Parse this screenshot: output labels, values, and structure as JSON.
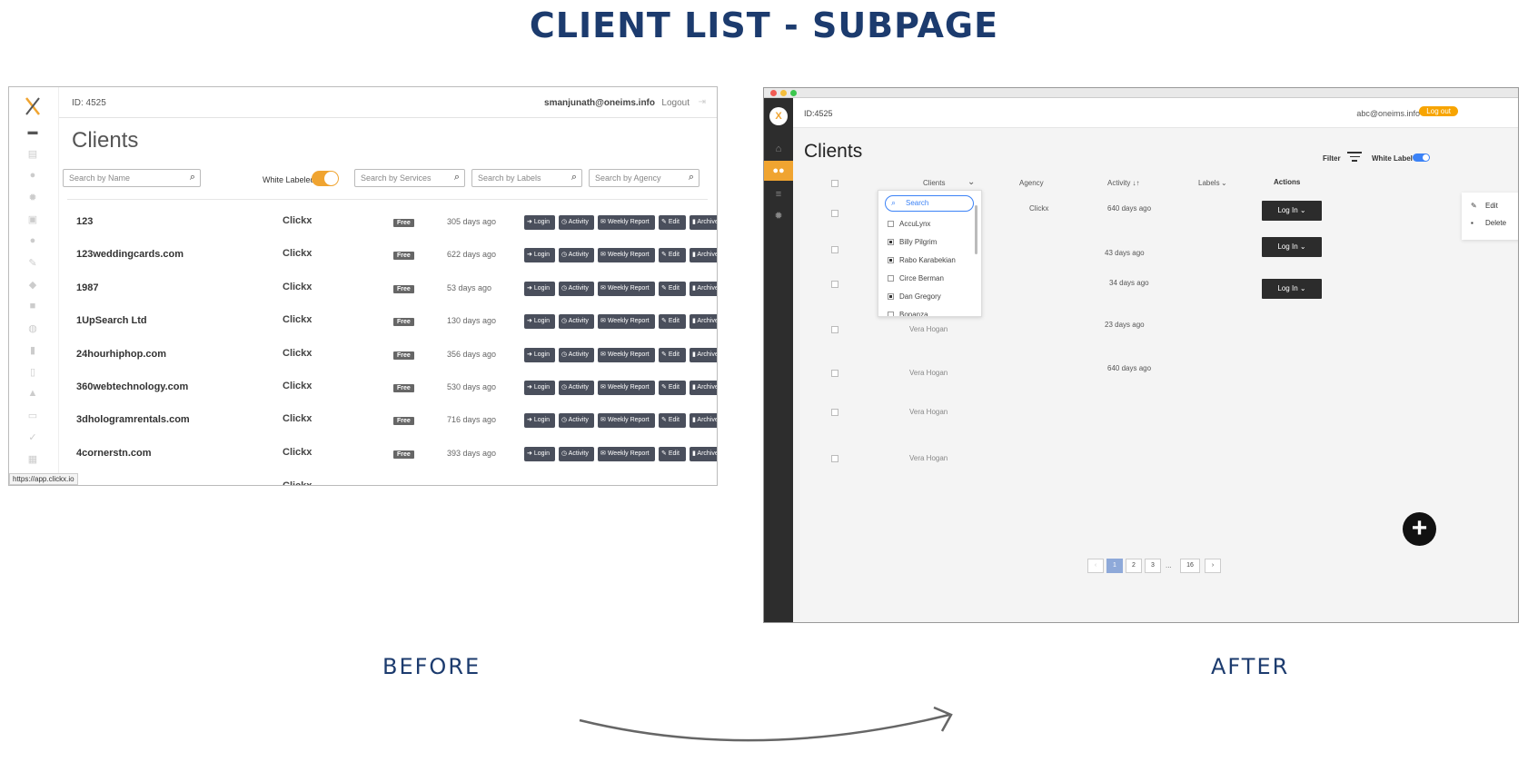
{
  "title": "CLIENT LIST - SUBPAGE",
  "captions": {
    "before": "BEFORE",
    "after": "AFTER"
  },
  "before": {
    "logo_icon": "x-logo-icon",
    "topbar": {
      "id": "ID: 4525",
      "email": "smanjunath@oneims.info",
      "logout": "Logout"
    },
    "heading": "Clients",
    "search": {
      "name": "Search by Name",
      "services": "Search by Services",
      "labels": "Search by Labels",
      "agency": "Search by Agency"
    },
    "white_labeled_label": "White Labeled",
    "white_labeled_on": true,
    "badge_label": "Free",
    "buttons": {
      "login": "Login",
      "activity": "Activity",
      "weekly_report": "Weekly Report",
      "edit": "Edit",
      "archive": "Archive"
    },
    "rows": [
      {
        "name": "123",
        "agency": "Clickx",
        "days": "305 days ago"
      },
      {
        "name": "123weddingcards.com",
        "agency": "Clickx",
        "days": "622 days ago"
      },
      {
        "name": "1987",
        "agency": "Clickx",
        "days": "53 days ago"
      },
      {
        "name": "1UpSearch Ltd",
        "agency": "Clickx",
        "days": "130 days ago"
      },
      {
        "name": "24hourhiphop.com",
        "agency": "Clickx",
        "days": "356 days ago"
      },
      {
        "name": "360webtechnology.com",
        "agency": "Clickx",
        "days": "530 days ago"
      },
      {
        "name": "3dhologramrentals.com",
        "agency": "Clickx",
        "days": "716 days ago"
      },
      {
        "name": "4cornerstn.com",
        "agency": "Clickx",
        "days": "393 days ago"
      }
    ],
    "status_url": "https://app.clickx.io"
  },
  "after": {
    "topbar": {
      "id": "ID:4525",
      "email": "abc@oneims.info",
      "logout": "Log out"
    },
    "heading": "Clients",
    "filter_label": "Filter",
    "white_label_label": "White Label",
    "white_label_on": true,
    "columns": {
      "clients": "Clients",
      "agency": "Agency",
      "activity": "Activity ↓↑",
      "labels": "Labels",
      "actions": "Actions"
    },
    "dropdown": {
      "search_placeholder": "Search",
      "items": [
        {
          "label": "AccuLynx",
          "checked": false
        },
        {
          "label": "Billy Pilgrim",
          "checked": true
        },
        {
          "label": "Rabo Karabekian",
          "checked": true
        },
        {
          "label": "Circe Berman",
          "checked": false
        },
        {
          "label": "Dan Gregory",
          "checked": true
        },
        {
          "label": "Bonanza",
          "checked": false
        }
      ]
    },
    "rows": [
      {
        "client": "",
        "agency": "Clickx",
        "days": "640 days ago",
        "login": "Log In"
      },
      {
        "client": "",
        "agency": "",
        "days": "43 days ago",
        "login": "Log In"
      },
      {
        "client": "",
        "agency": "",
        "days": "34 days ago",
        "login": "Log In"
      },
      {
        "client": "Vera Hogan",
        "agency": "",
        "days": "23 days ago",
        "login": ""
      },
      {
        "client": "Vera Hogan",
        "agency": "",
        "days": "640 days ago",
        "login": ""
      },
      {
        "client": "Vera Hogan",
        "agency": "",
        "days": "",
        "login": ""
      },
      {
        "client": "Vera Hogan",
        "agency": "",
        "days": "",
        "login": ""
      }
    ],
    "row_menu": {
      "edit": "Edit",
      "delete": "Delete"
    },
    "pagination": {
      "prev": "‹",
      "pages": [
        "1",
        "2",
        "3"
      ],
      "ellipsis": "...",
      "last": "16",
      "next": "›",
      "current": "1"
    }
  }
}
